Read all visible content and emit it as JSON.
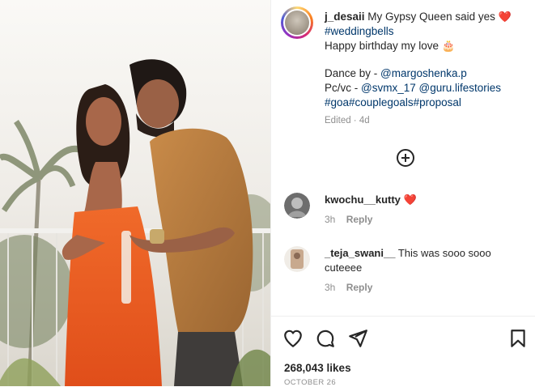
{
  "post": {
    "username": "j_desaii",
    "caption_lines": [
      "My Gypsy Queen said yes",
      "#weddingbells",
      "Happy birthday my love",
      "Dance by - ",
      "@margoshenka.p",
      "Pc/vc - ",
      "@svmx_17 @guru.lifestories",
      "#goa#couplegoals#proposal"
    ],
    "heart_emoji": "❤️",
    "cake_emoji": "🎂",
    "edited": "Edited · 4d"
  },
  "comments": [
    {
      "username": "kwochu__kutty",
      "text": "",
      "emoji": "❤️",
      "time": "3h",
      "reply": "Reply"
    },
    {
      "username": "_teja_swani__",
      "text": "This was sooo sooo cuteeee",
      "time": "3h",
      "reply": "Reply"
    }
  ],
  "actions": {
    "likes": "268,043 likes",
    "date": "OCTOBER 26"
  },
  "icons": [
    "heart-icon",
    "comment-icon",
    "share-icon",
    "bookmark-icon",
    "plus-circle-icon"
  ],
  "colors": {
    "link": "#00376b",
    "heart": "#ed4956",
    "muted": "#8e8e8e"
  }
}
